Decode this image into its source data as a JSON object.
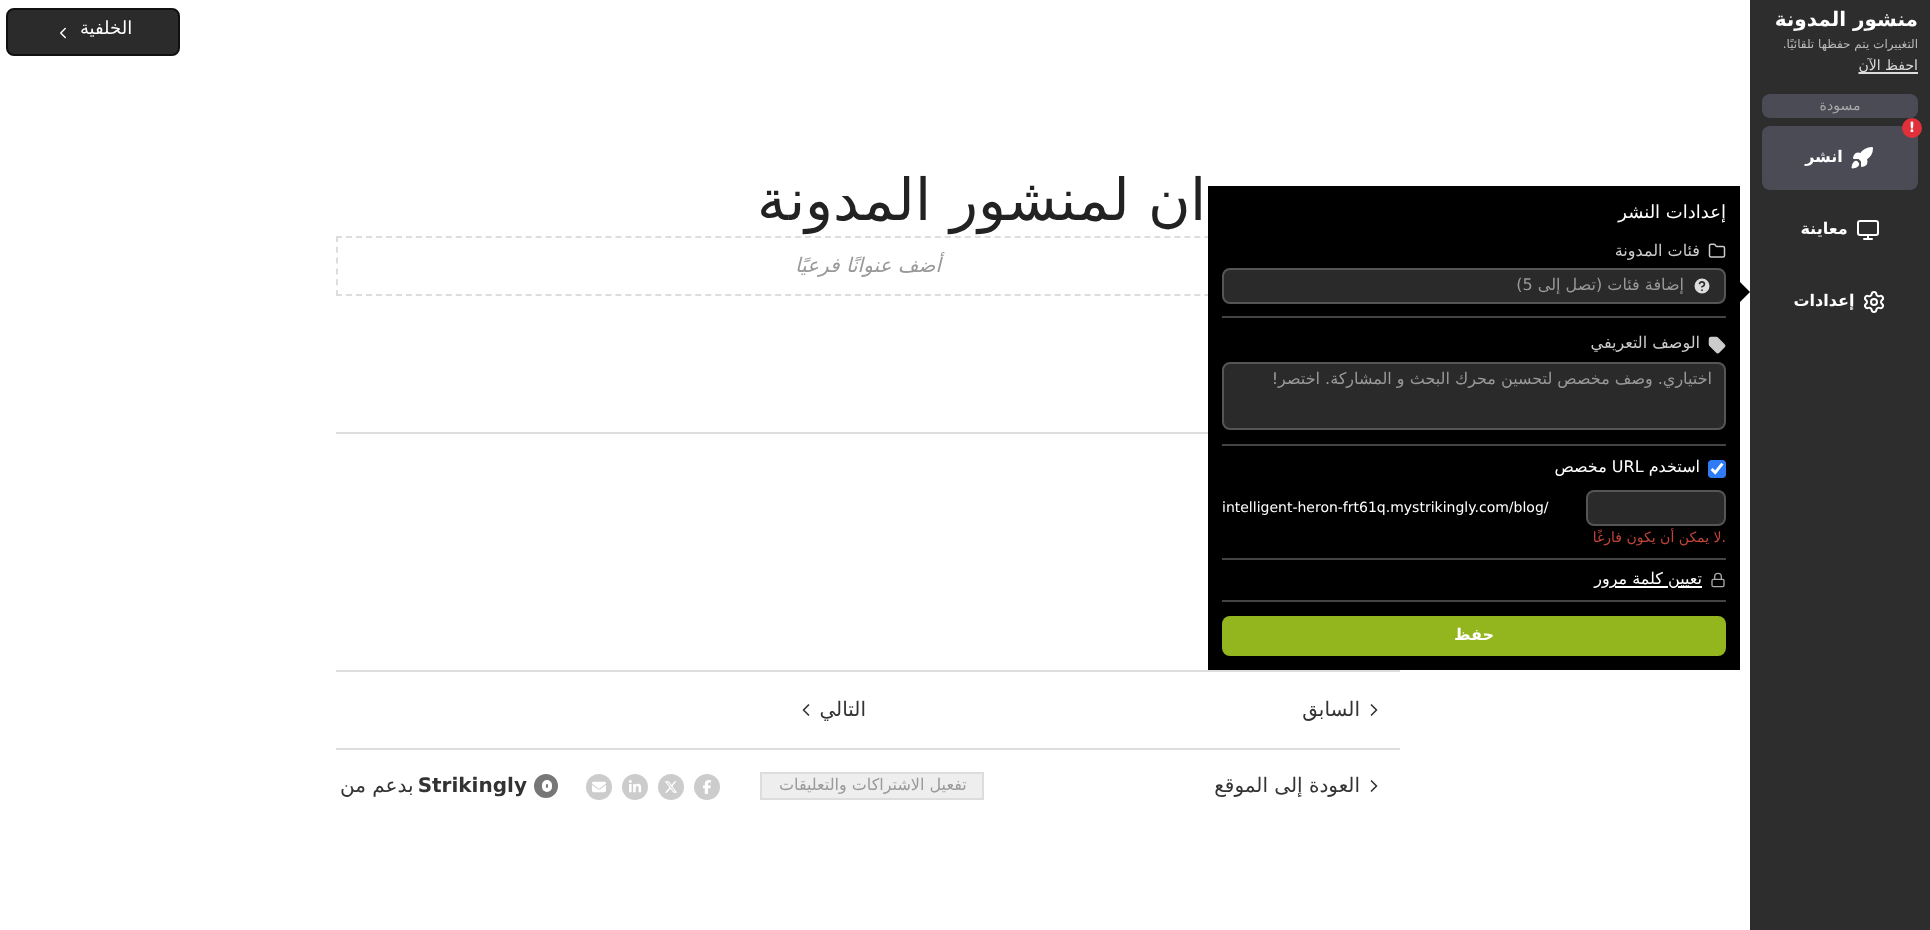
{
  "back_button": {
    "label": "الخلفية"
  },
  "post": {
    "title": "ان لمنشور المدونة",
    "subtitle_placeholder": "أضف عنوانًا فرعيًا"
  },
  "pager": {
    "previous": "السابق",
    "next": "التالي"
  },
  "footer": {
    "back_to_site": "العودة إلى الموقع",
    "enable_button": "تفعيل الاشتراكات والتعليقات",
    "brand": "Strikingly",
    "powered_by": "بدعم من"
  },
  "publish_settings": {
    "title": "إعدادات النشر",
    "categories_label": "فئات المدونة",
    "categories_placeholder": "إضافة فئات (تصل إلى 5)",
    "description_label": "الوصف التعريفي",
    "description_placeholder": "اختياري. وصف مخصص لتحسين محرك البحث و المشاركة. اختصر!",
    "custom_url": {
      "label": "استخدم URL مخصص",
      "checked": true
    },
    "url_prefix": "intelligent-heron-frt61q.mystrikingly.com/blog/",
    "url_error": ".لا يمكن أن يكون فارغًا",
    "password_link": "تعيين كلمة مرور",
    "save_button": "حفظ"
  },
  "sidebar": {
    "title": "منشور المدونة",
    "autosave_note": "التغييرات يتم حفظها تلقائيًا.",
    "save_now": "احفظ الآن",
    "status_badge": "مسودة",
    "items": [
      {
        "kind": "publish",
        "label": "انشر",
        "selected": true,
        "alert": "!"
      },
      {
        "kind": "preview",
        "label": "معاينة",
        "selected": false
      },
      {
        "kind": "settings",
        "label": "إعدادات",
        "selected": false
      }
    ]
  }
}
